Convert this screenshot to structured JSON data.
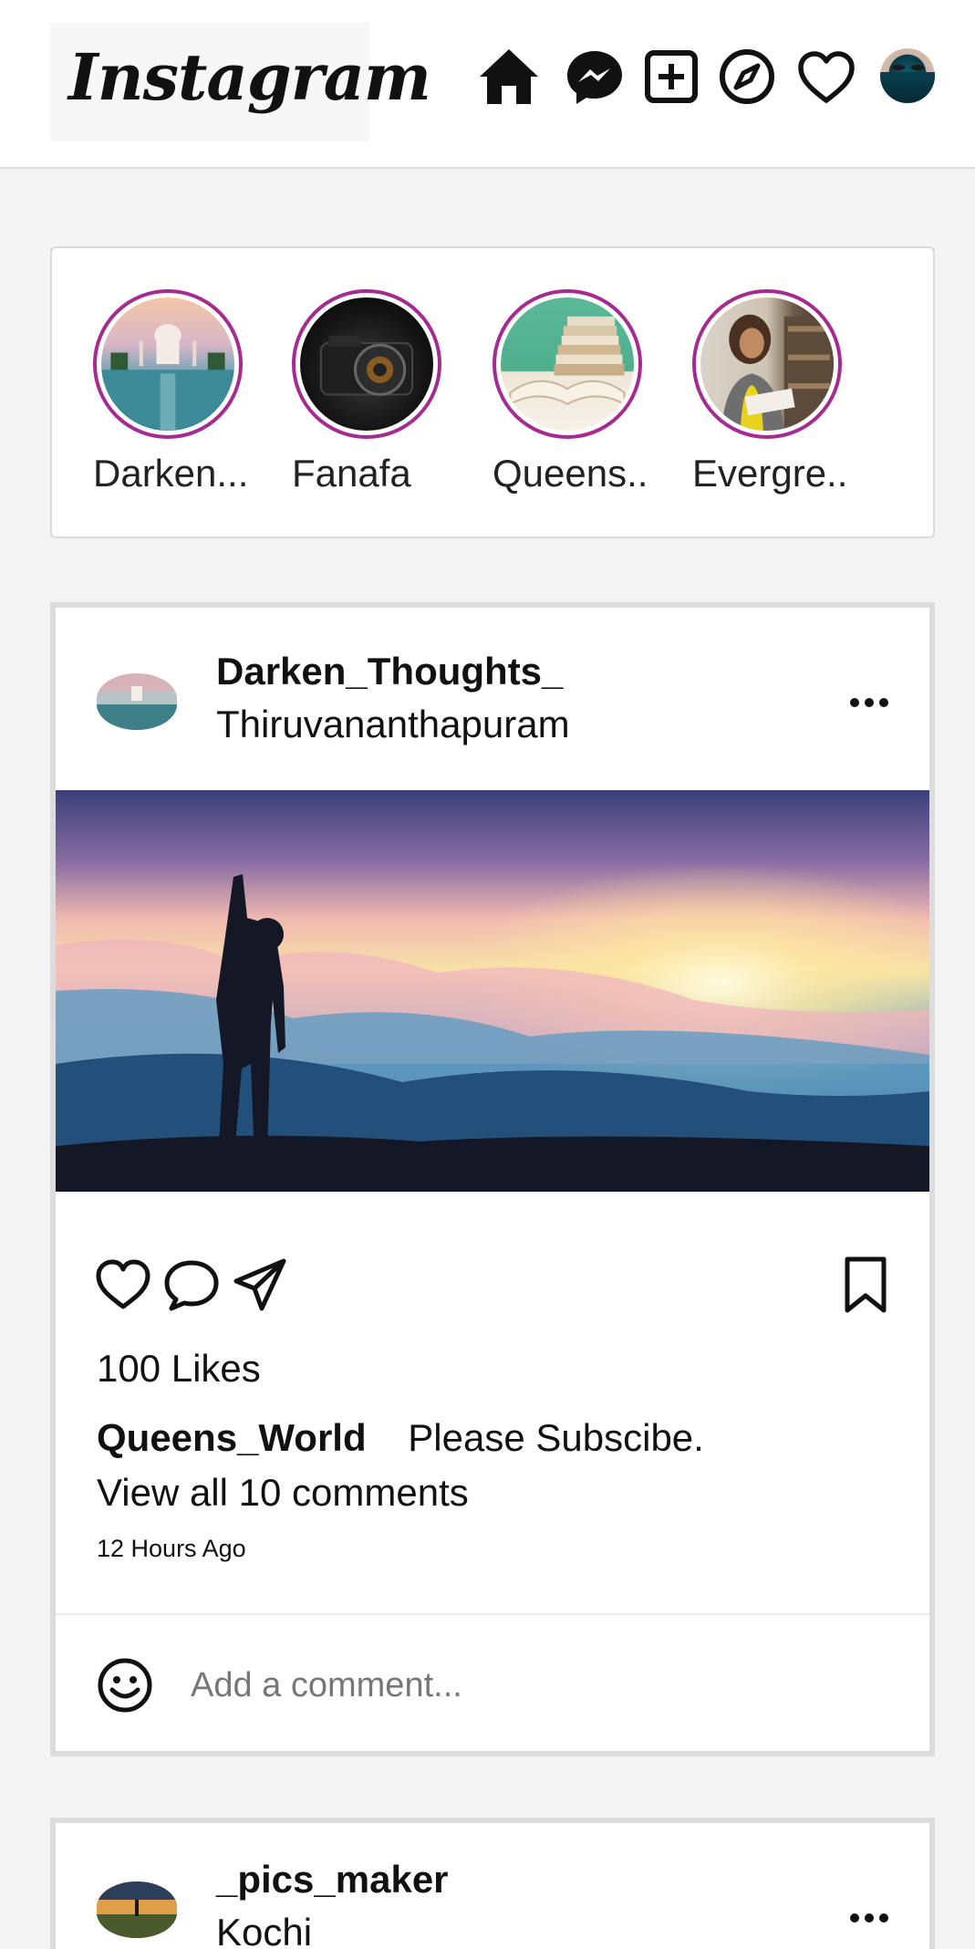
{
  "header": {
    "logo_text": "Instagram",
    "icons": [
      "home-icon",
      "messenger-icon",
      "new-post-icon",
      "explore-icon",
      "activity-heart-icon",
      "profile-avatar"
    ]
  },
  "stories": [
    {
      "label": "Darken..."
    },
    {
      "label": "Fanafa"
    },
    {
      "label": "Queens..."
    },
    {
      "label": "Evergre..."
    }
  ],
  "posts": [
    {
      "username": "Darken_Thoughts_",
      "location": "Thiruvananthapuram",
      "likes": "100 Likes",
      "caption_user": "Queens_World",
      "caption_text": "Please Subscibe.",
      "view_comments": "View all 10 comments",
      "time": "12 Hours Ago",
      "comment_placeholder": "Add a comment..."
    },
    {
      "username": "_pics_maker",
      "location": "Kochi"
    }
  ],
  "colors": {
    "story_ring": "#a52a91",
    "background": "#f4f4f4",
    "card_border": "#dcdcdc"
  }
}
